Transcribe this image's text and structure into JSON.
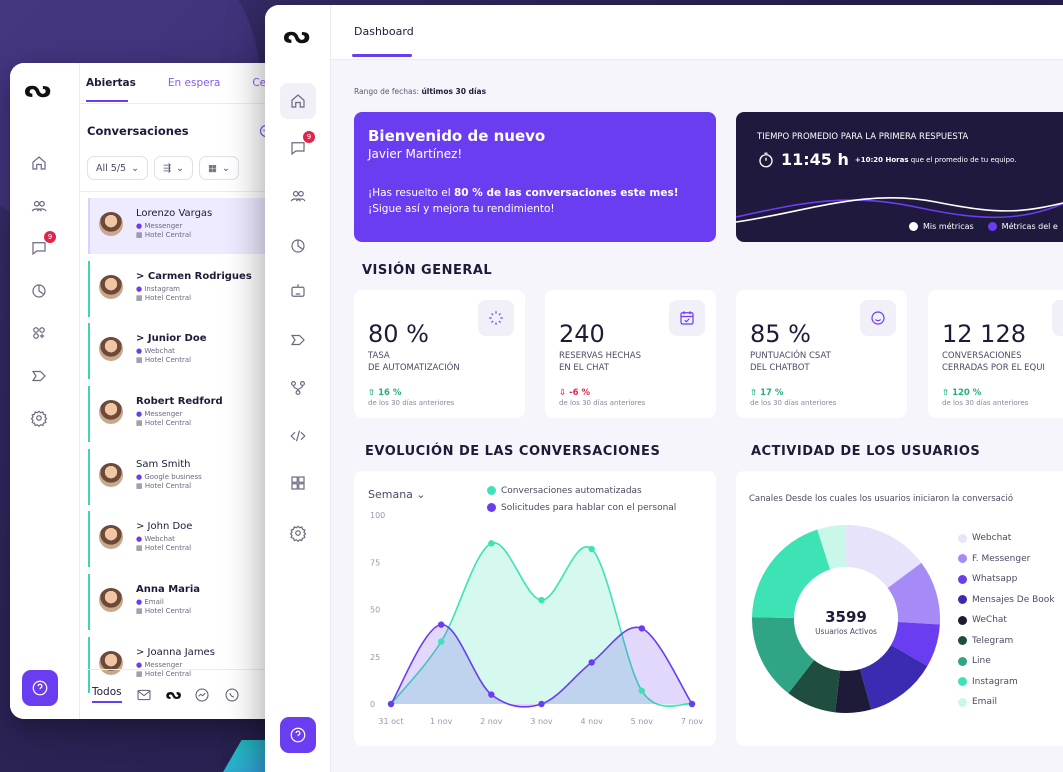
{
  "back": {
    "tabs": [
      "Abiertas",
      "En espera",
      "Cerra"
    ],
    "conversations_title": "Conversaciones",
    "filter_all": "All 5/5",
    "conversations": [
      {
        "name": "Lorenzo Vargas",
        "channel": "Messenger",
        "hotel": "Hotel Central",
        "bold": false,
        "selected": true
      },
      {
        "name": "> Carmen Rodrigues",
        "channel": "Instagram",
        "hotel": "Hotel Central",
        "bold": true,
        "selected": false
      },
      {
        "name": "> Junior Doe",
        "channel": "Webchat",
        "hotel": "Hotel Central",
        "bold": true,
        "selected": false
      },
      {
        "name": "Robert Redford",
        "channel": "Messenger",
        "hotel": "Hotel Central",
        "bold": true,
        "selected": false
      },
      {
        "name": "Sam Smith",
        "channel": "Google business",
        "hotel": "Hotel Central",
        "bold": false,
        "selected": false
      },
      {
        "name": "> John Doe",
        "channel": "Webchat",
        "hotel": "Hotel Central",
        "bold": false,
        "selected": false
      },
      {
        "name": "Anna Maria",
        "channel": "Email",
        "hotel": "Hotel Central",
        "bold": true,
        "selected": false
      },
      {
        "name": "> Joanna James",
        "channel": "Messenger",
        "hotel": "Hotel Central",
        "bold": false,
        "selected": false
      }
    ],
    "bottom_all": "Todos",
    "badge": "9"
  },
  "front": {
    "tab": "Dashboard",
    "badge": "9",
    "range_label": "Rango de fechas:",
    "range_value": "últimos 30 días",
    "welcome": {
      "title": "Bienvenido de nuevo",
      "name": "Javier Martínez!",
      "msg_pre": "¡Has resuelto el ",
      "msg_bold": "80 % de las conversaciones este mes!",
      "msg_line2": "¡Sigue así y mejora tu rendimiento!"
    },
    "response": {
      "label": "TIEMPO PROMEDIO PARA LA PRIMERA RESPUESTA",
      "time": "11:45 h",
      "delta": "+10:20 Horas",
      "delta_text": "que el promedio de tu equipo.",
      "legend_mine": "Mis métricas",
      "legend_team": "Métricas del e",
      "color_mine": "#ffffff",
      "color_team": "#6a3df0"
    },
    "overview_title": "VISIÓN GENERAL",
    "kpis": [
      {
        "value": "80 %",
        "label1": "TASA",
        "label2": "DE AUTOMATIZACIÓN",
        "change": "16 %",
        "dir": "up",
        "sub": "de los 30 días anteriores",
        "icon": "loading-icon"
      },
      {
        "value": "240",
        "label1": "RESERVAS HECHAS",
        "label2": "EN EL CHAT",
        "change": "-6 %",
        "dir": "down",
        "sub": "de los 30 días anteriores",
        "icon": "calendar-icon"
      },
      {
        "value": "85 %",
        "label1": "PUNTUACIÓN CSAT",
        "label2": "DEL CHATBOT",
        "change": "17 %",
        "dir": "up",
        "sub": "de los 30 días anteriores",
        "icon": "smile-icon"
      },
      {
        "value": "12 128",
        "label1": "CONVERSACIONES",
        "label2": "CERRADAS POR EL EQUI",
        "change": "120 %",
        "dir": "up",
        "sub": "de los 30 días anteriores",
        "icon": "users-icon"
      }
    ],
    "evolution_title": "EVOLUCIÓN DE LAS CONVERSACIONES",
    "activity_title": "ACTIVIDAD DE LOS USUARIOS",
    "period": "Semana",
    "activity_subtitle": "Canales Desde los cuales los usuarios iniciaron la conversació",
    "donut_value": "3599",
    "donut_label": "Usuarios Activos"
  },
  "chart_data": [
    {
      "type": "area",
      "categories": [
        "31 oct",
        "1 nov",
        "2 nov",
        "3 nov",
        "4 nov",
        "5 nov",
        "7 nov"
      ],
      "ylim": [
        0,
        100
      ],
      "yticks": [
        "100",
        "75",
        "50",
        "25",
        "0"
      ],
      "series": [
        {
          "name": "Conversaciones automatizadas",
          "values": [
            0,
            33,
            85,
            55,
            82,
            7,
            0
          ],
          "color": "#3ee3b5"
        },
        {
          "name": "Solicitudes para hablar con el personal",
          "values": [
            0,
            42,
            5,
            0,
            22,
            40,
            0
          ],
          "color": "#6a3df0"
        }
      ]
    },
    {
      "type": "pie",
      "total": "3599",
      "slices": [
        {
          "name": "Webchat",
          "value": 12,
          "color": "#e6e3fb"
        },
        {
          "name": "F. Messenger",
          "value": 9,
          "color": "#a68bf6"
        },
        {
          "name": "Whatsapp",
          "value": 6,
          "color": "#6a3df0"
        },
        {
          "name": "Mensajes De Book",
          "value": 10,
          "color": "#3a2bb0"
        },
        {
          "name": "WeChat",
          "value": 5,
          "color": "#1e1b39"
        },
        {
          "name": "Telegram",
          "value": 7,
          "color": "#1f4d3f"
        },
        {
          "name": "Line",
          "value": 12,
          "color": "#2fa586"
        },
        {
          "name": "Instagram",
          "value": 16,
          "color": "#3ee3b5"
        },
        {
          "name": "Email",
          "value": 4,
          "color": "#c9f7ea"
        }
      ]
    }
  ]
}
